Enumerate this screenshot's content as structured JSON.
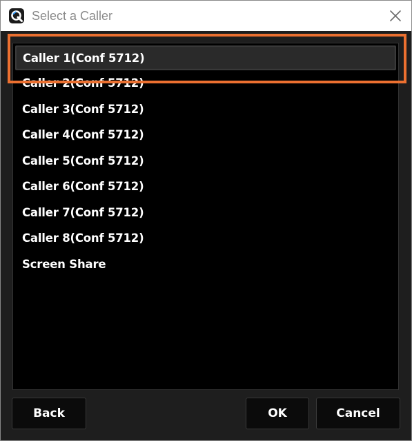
{
  "window": {
    "title": "Select a Caller"
  },
  "callers": {
    "items": [
      {
        "label": "Caller 1(Conf 5712)",
        "selected": true
      },
      {
        "label": "Caller 2(Conf 5712)",
        "selected": false
      },
      {
        "label": "Caller 3(Conf 5712)",
        "selected": false
      },
      {
        "label": "Caller 4(Conf 5712)",
        "selected": false
      },
      {
        "label": "Caller 5(Conf 5712)",
        "selected": false
      },
      {
        "label": "Caller 6(Conf 5712)",
        "selected": false
      },
      {
        "label": "Caller 7(Conf 5712)",
        "selected": false
      },
      {
        "label": "Caller 8(Conf 5712)",
        "selected": false
      },
      {
        "label": "Screen Share",
        "selected": false
      }
    ]
  },
  "buttons": {
    "back_label": "Back",
    "ok_label": "OK",
    "cancel_label": "Cancel"
  },
  "colors": {
    "highlight": "#ec7030",
    "background": "#1e1e1e",
    "list_background": "#000000",
    "text": "#ffffff"
  },
  "icons": {
    "app": "app-logo-icon",
    "close": "close-icon"
  }
}
